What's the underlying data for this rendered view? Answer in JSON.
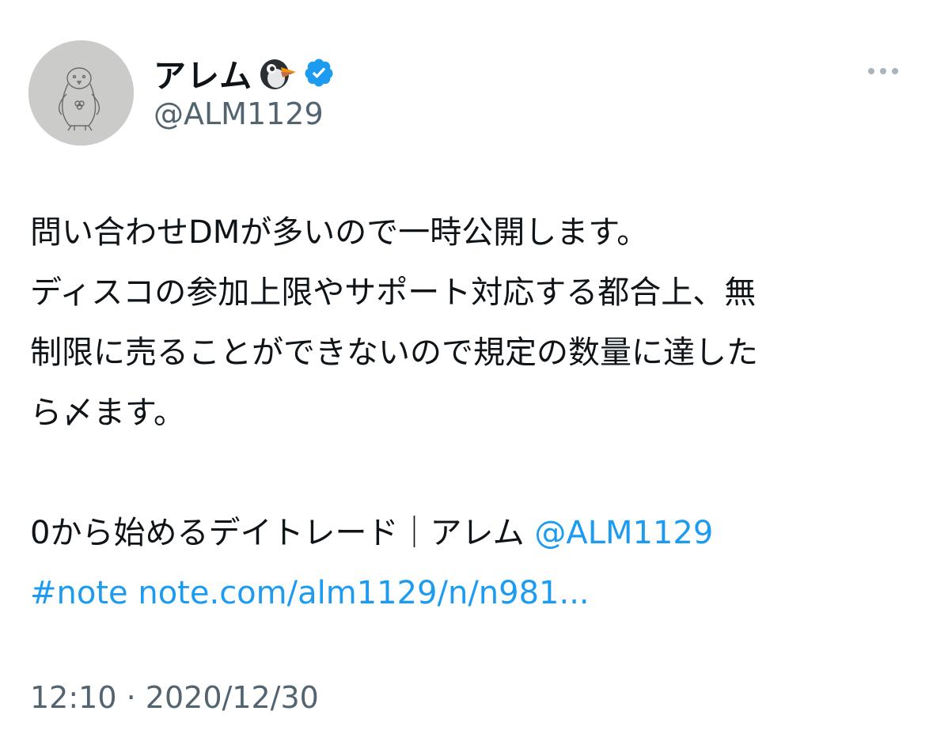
{
  "user": {
    "display_name": "アレム",
    "handle": "@ALM1129",
    "emoji_icon": "penguin-emoji",
    "verified_icon": "verified-badge-icon"
  },
  "tweet": {
    "lines": [
      "問い合わせDMが多いので一時公開します。",
      "ディスコの参加上限やサポート対応する都合上、無",
      "制限に売ることができないので規定の数量に達した",
      "ら〆ます。"
    ],
    "note_title": "0から始めるデイトレード｜アレム",
    "mention": "@ALM1129",
    "hashtag": "#note",
    "url": "note.com/alm1129/n/n981..."
  },
  "footer": {
    "time": "12:10",
    "separator": "·",
    "date": "2020/12/30"
  },
  "colors": {
    "link": "#1d9bf0",
    "secondary_text": "#536471",
    "primary_text": "#0f1419",
    "verified": "#1d9bf0"
  }
}
